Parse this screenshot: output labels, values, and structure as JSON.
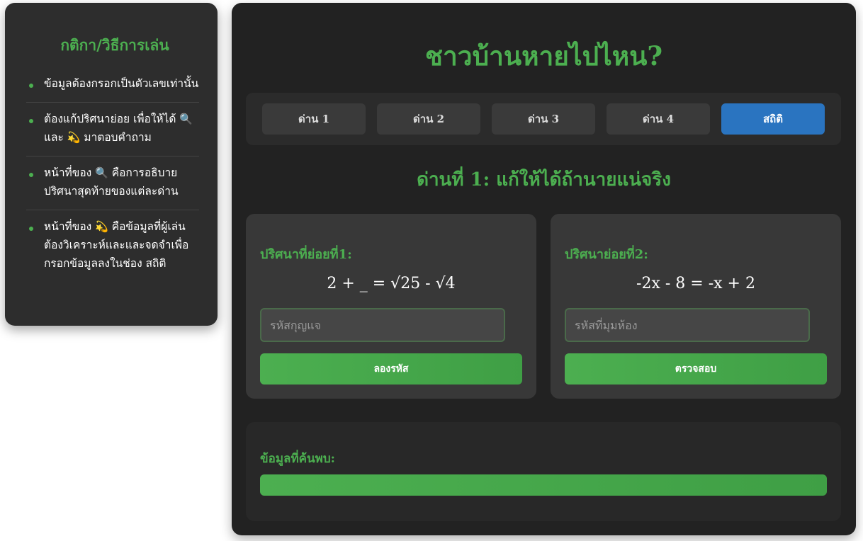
{
  "sidebar": {
    "title": "กติกา/วิธีการเล่น",
    "rules": [
      {
        "text": "ข้อมูลต้องกรอกเป็นตัวเลขเท่านั้น"
      },
      {
        "pre": "ต้องแก้ปริศนาย่อย เพื่อให้ได้ ",
        "icon1": "🔍",
        "mid": " และ ",
        "icon2": "💫",
        "post": " มาตอบคำถาม"
      },
      {
        "pre": "หน้าที่ของ ",
        "icon": "🔍",
        "post": " คือการอธิบายปริศนาสุดท้ายของแต่ละด่าน"
      },
      {
        "pre": "หน้าที่ของ ",
        "icon": "💫",
        "post": " คือข้อมูลที่ผู้เล่นต้องวิเคราะห์และและจดจำเพื่อกรอกข้อมูลลงในช่อง สถิติ"
      }
    ]
  },
  "main": {
    "title": "ชาวบ้านหายไปไหน?",
    "tabs": [
      {
        "label": "ด่าน 1"
      },
      {
        "label": "ด่าน 2"
      },
      {
        "label": "ด่าน 3"
      },
      {
        "label": "ด่าน 4"
      },
      {
        "label": "สถิติ",
        "active": true
      }
    ],
    "level_title": "ด่านที่ 1: แก้ให้ได้ถ้านายแน่จริง",
    "puzzles": [
      {
        "title": "ปริศนาที่ย่อยที่1:",
        "equation": "2 + _ = √25 - √4",
        "placeholder": "รหัสกุญแจ",
        "value": "",
        "button": "ลองรหัส"
      },
      {
        "title": "ปริศนาย่อยที่2:",
        "equation": "-2x - 8 = -x + 2",
        "placeholder": "รหัสที่มุมห้อง",
        "value": "",
        "button": "ตรวจสอบ"
      }
    ],
    "found_label": "ข้อมูลที่ค้นพบ:"
  },
  "colors": {
    "accent": "#4caf50",
    "active_tab": "#2a74c0",
    "panel": "#222222"
  }
}
